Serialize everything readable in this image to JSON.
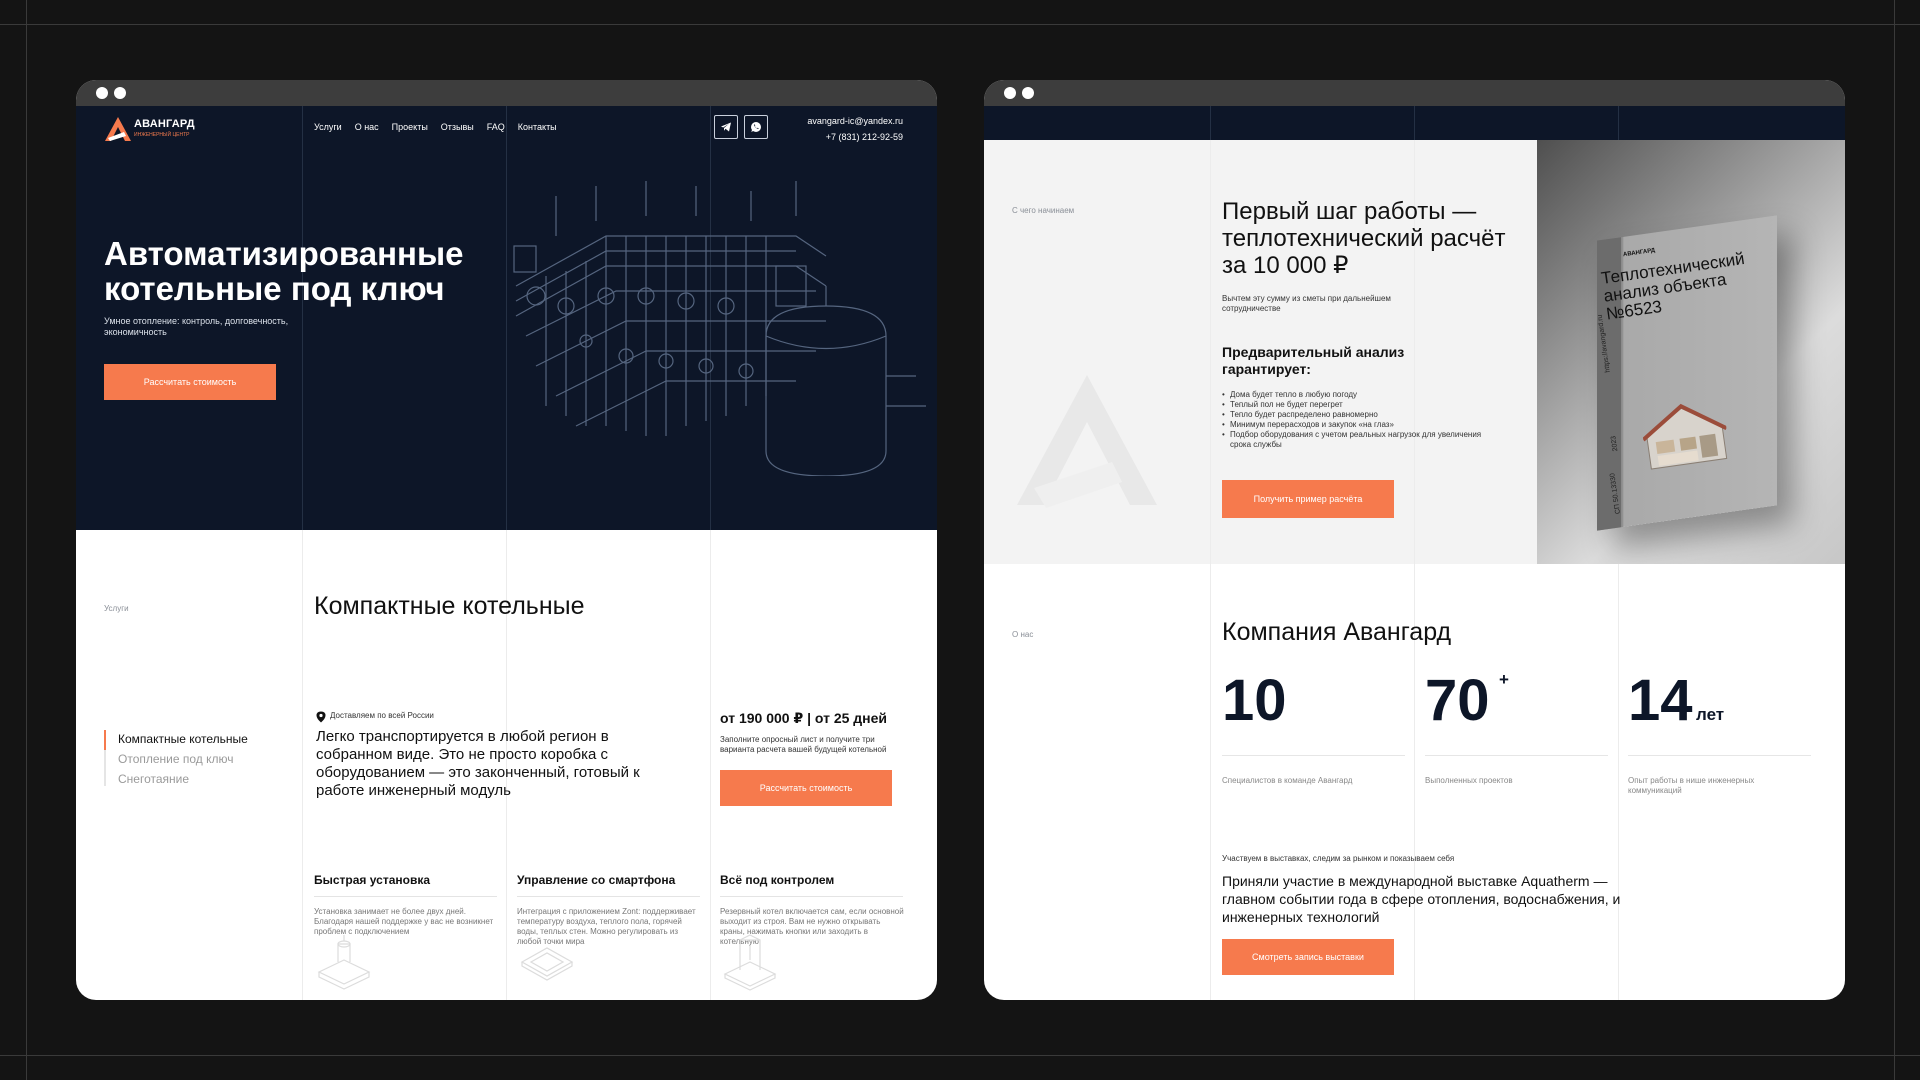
{
  "brand": {
    "name": "АВАНГАРД",
    "tagline": "ИНЖЕНЕРНЫЙ ЦЕНТР",
    "accent": "#f67a4d",
    "navy": "#0d1628"
  },
  "nav": {
    "items": [
      "Услуги",
      "О нас",
      "Проекты",
      "Отзывы",
      "FAQ",
      "Контакты"
    ]
  },
  "contacts": {
    "email": "avangard-ic@yandex.ru",
    "phone": "+7 (831) 212-92-59",
    "icons": [
      "telegram-icon",
      "whatsapp-icon"
    ]
  },
  "hero": {
    "title": "Автоматизированные котельные под ключ",
    "subtitle": "Умное отопление: контроль, долговечность, экономичность",
    "cta": "Рассчитать стоимость"
  },
  "services": {
    "label": "Услуги",
    "title": "Компактные котельные",
    "menu": [
      {
        "label": "Компактные котельные",
        "active": true
      },
      {
        "label": "Отопление под ключ",
        "active": false
      },
      {
        "label": "Снеготаяние",
        "active": false
      }
    ],
    "delivery": "Доставляем по всей России",
    "lead": "Легко транспортируется в любой регион в собранном виде. Это не просто коробка с оборудованием — это законченный, готовый к работе инженерный модуль",
    "price": "от 190 000 ₽ | от 25 дней",
    "price_note": "Заполните опросный лист и получите три варианта расчета вашей будущей котельной",
    "cta": "Рассчитать стоимость",
    "features": [
      {
        "title": "Быстрая установка",
        "text": "Установка занимает не более двух дней. Благодаря нашей поддержке у вас не возникнет проблем с подключением"
      },
      {
        "title": "Управление со смартфона",
        "text": "Интеграция с приложением Zont: поддерживает температуру воздуха, теплого пола, горячей воды, теплых стен. Можно регулировать из любой точки мира"
      },
      {
        "title": "Всё под контролем",
        "text": "Резервный котел включается сам, если основной выходит из строя. Вам не нужно открывать краны, нажимать кнопки или заходить в котельную"
      }
    ]
  },
  "first_step": {
    "label": "С чего начинаем",
    "title": "Первый шаг работы — теплотехнический расчёт за 10 000 ₽",
    "note": "Вычтем эту сумму из сметы при дальнейшем сотрудничестве",
    "guarantee_title": "Предварительный анализ гарантирует:",
    "guarantees": [
      "Дома будет тепло в любую погоду",
      "Теплый пол не будет перегрет",
      "Тепло будет распределено равномерно",
      "Минимум перерасходов и закупок «на глаз»",
      "Подбор оборудования с учетом реальных нагрузок для увеличения срока службы"
    ],
    "cta": "Получить пример расчёта",
    "book": {
      "title": "Теплотехнический анализ объекта №6523",
      "logo": "АВАНГАРД",
      "spine": "https://avangard.ru",
      "year": "2023",
      "code": "СП 50.13330"
    }
  },
  "about": {
    "label": "О нас",
    "title": "Компания Авангард",
    "stats": [
      {
        "value": "10",
        "suffix": "",
        "label": "Специалистов в команде Авангард"
      },
      {
        "value": "70",
        "suffix": "+",
        "label": "Выполненных проектов"
      },
      {
        "value": "14",
        "suffix": "лет",
        "label": "Опыт работы в нише инженерных коммуникаций"
      }
    ],
    "expo_sub": "Участвуем в выставках, следим за рынком и показываем себя",
    "expo_title": "Приняли участие в международной выставке Aquatherm — главном событии года в сфере отопления, водоснабжения, и инженерных технологий",
    "cta": "Смотреть запись выставки"
  }
}
